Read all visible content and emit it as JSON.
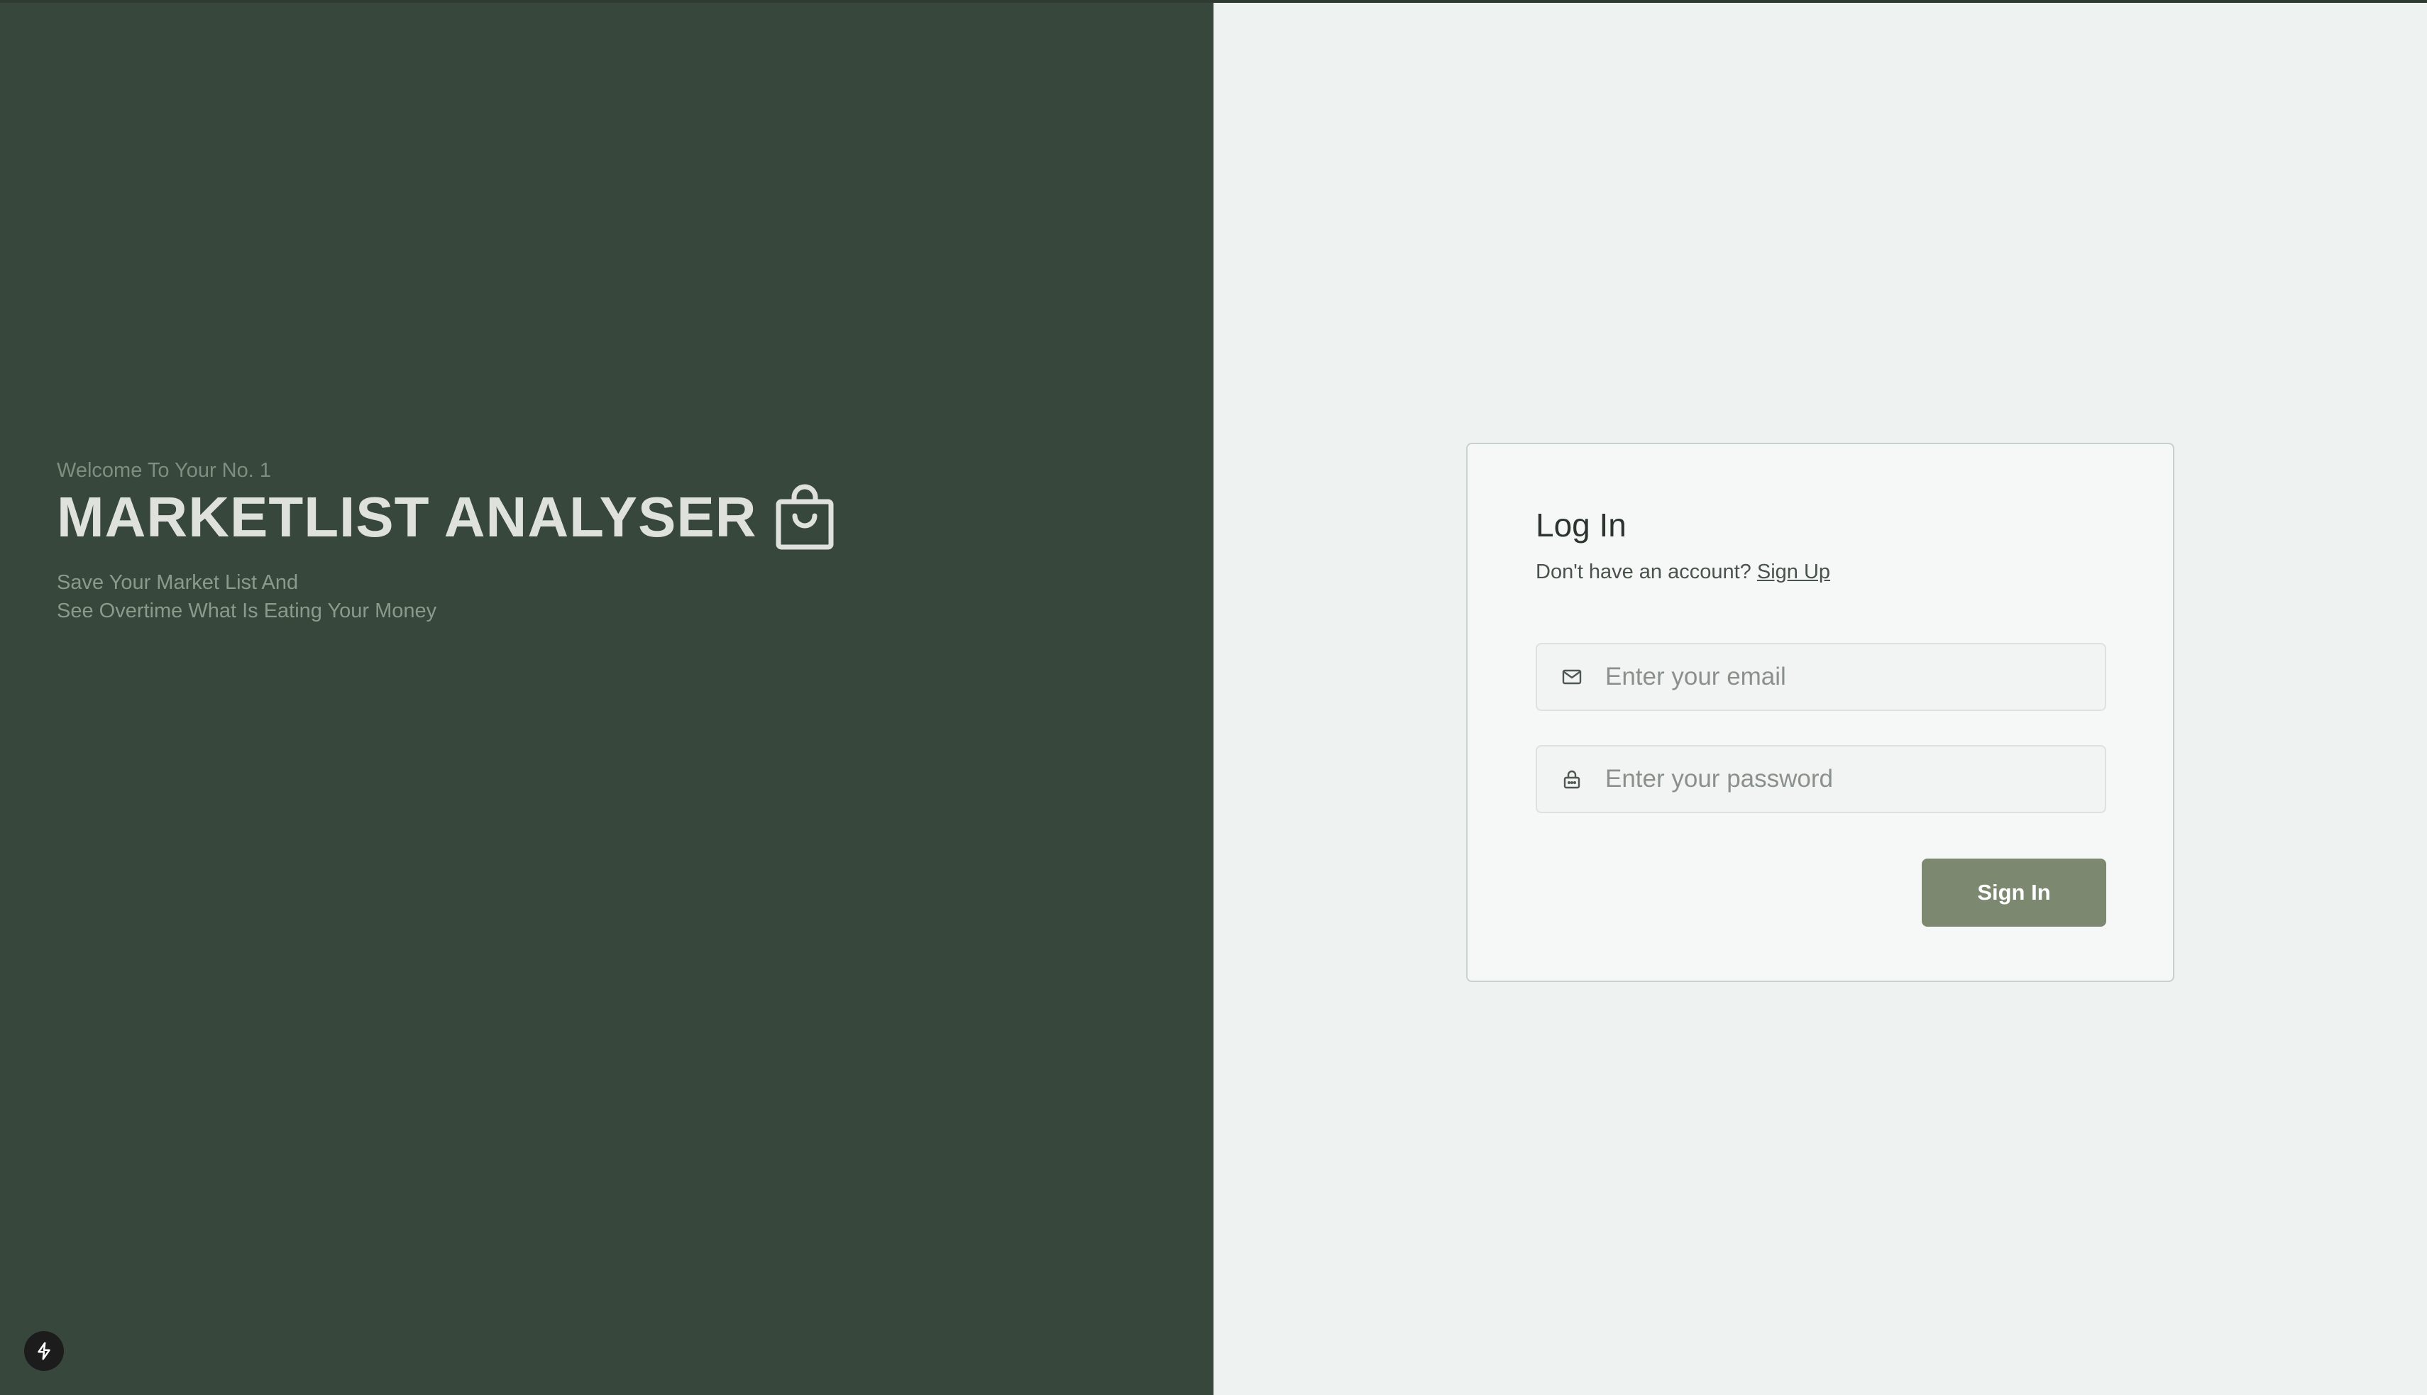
{
  "hero": {
    "welcome": "Welcome To Your No. 1",
    "title": "MARKETLIST ANALYSER",
    "tagline_line1": "Save Your Market List And",
    "tagline_line2": "See Overtime What Is Eating Your Money",
    "icon": "shopping-bag-icon"
  },
  "login": {
    "title": "Log In",
    "no_account_text": "Don't have an account?",
    "signup_label": "Sign Up",
    "email": {
      "placeholder": "Enter your email",
      "value": "",
      "icon": "mail-icon"
    },
    "password": {
      "placeholder": "Enter your password",
      "value": "",
      "icon": "lock-icon"
    },
    "signin_label": "Sign In"
  },
  "badge": {
    "icon": "lightning-icon"
  },
  "colors": {
    "left_panel": "#37473b",
    "right_panel": "#eef3f1",
    "button": "#7c8870",
    "title_text": "#dfe2dc"
  }
}
